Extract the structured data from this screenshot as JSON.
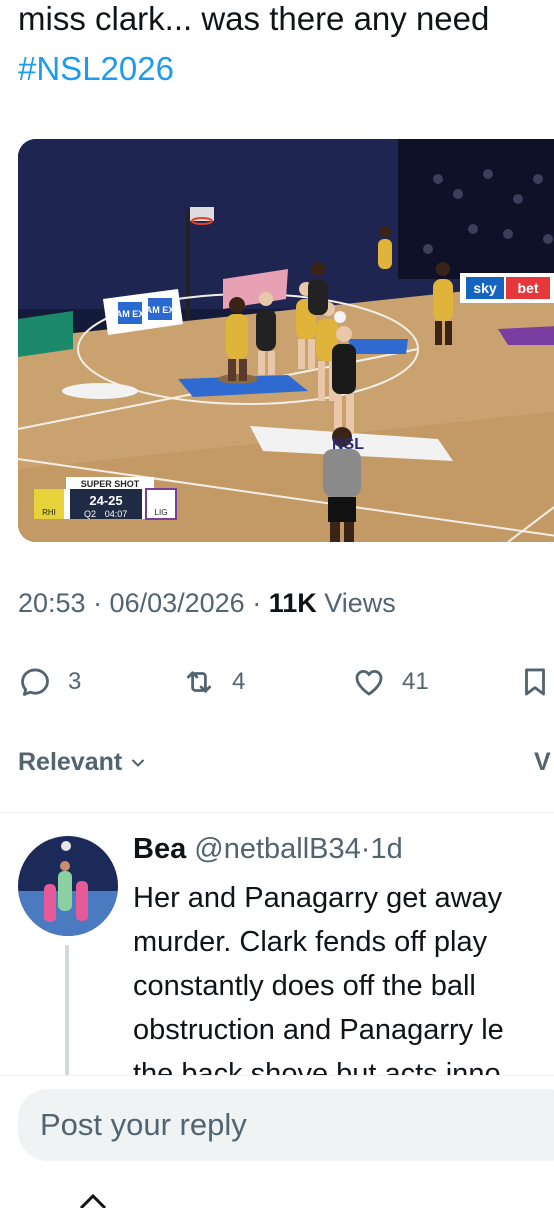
{
  "tweet": {
    "text": "miss clark... was there any need",
    "hashtag": "#NSL2026",
    "timestamp": "20:53 · 06/03/2026 · ",
    "views_count": "11K",
    "views_label": " Views"
  },
  "media": {
    "scoreboard": {
      "label": "SUPER SHOT",
      "score": "24-25",
      "quarter": "Q2",
      "clock": "04:07",
      "home": "RHI",
      "away": "LIG"
    },
    "signs": [
      "AM EX",
      "AM EX",
      "sky",
      "bet",
      "NSL"
    ]
  },
  "actions": {
    "replies": "3",
    "reposts": "4",
    "likes": "41"
  },
  "sort": {
    "label": "Relevant",
    "right_label": "V"
  },
  "reply": {
    "name": "Bea",
    "handle": "@netballB34",
    "dot": "·",
    "time": "1d",
    "lines": [
      "Her and Panagarry get away",
      "murder. Clark fends off play",
      "constantly does off the ball",
      "obstruction and Panagarry le",
      "the back shove but acts inno"
    ]
  },
  "composer": {
    "placeholder": "Post your reply"
  },
  "colors": {
    "accent": "#1d9bf0",
    "text_secondary": "#536471",
    "court": "#c9a26f"
  }
}
